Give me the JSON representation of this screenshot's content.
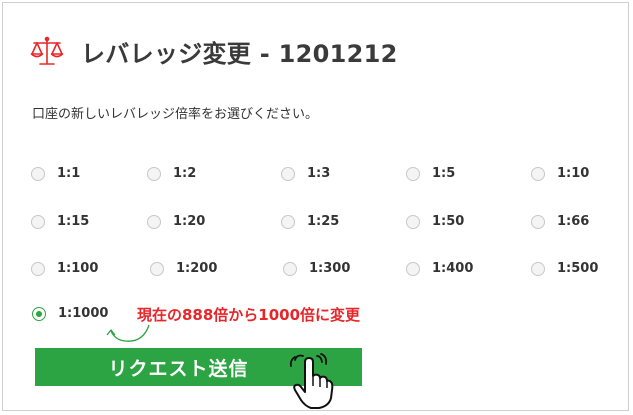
{
  "dialog": {
    "title": "レバレッジ変更 - 1201212",
    "instruction": "口座の新しいレバレッジ倍率をお選びください。",
    "icon": "balance-scale-icon",
    "accent_color": "#e8262a"
  },
  "leverage_options": [
    {
      "label": "1:1",
      "checked": false
    },
    {
      "label": "1:2",
      "checked": false
    },
    {
      "label": "1:3",
      "checked": false
    },
    {
      "label": "1:5",
      "checked": false
    },
    {
      "label": "1:10",
      "checked": false
    },
    {
      "label": "1:15",
      "checked": false
    },
    {
      "label": "1:20",
      "checked": false
    },
    {
      "label": "1:25",
      "checked": false
    },
    {
      "label": "1:50",
      "checked": false
    },
    {
      "label": "1:66",
      "checked": false
    },
    {
      "label": "1:100",
      "checked": false
    },
    {
      "label": "1:200",
      "checked": false
    },
    {
      "label": "1:300",
      "checked": false
    },
    {
      "label": "1:400",
      "checked": false
    },
    {
      "label": "1:500",
      "checked": false
    },
    {
      "label": "1:1000",
      "checked": true
    }
  ],
  "annotation": {
    "text": "現在の888倍から1000倍に変更",
    "color": "#e8262a"
  },
  "submit": {
    "label": "リクエスト送信",
    "color": "#2ca444",
    "cursor_icon": "pointing-hand-icon"
  }
}
